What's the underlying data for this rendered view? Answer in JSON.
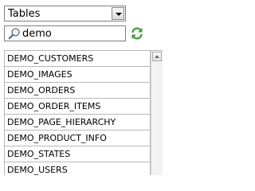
{
  "object_type": {
    "selected": "Tables",
    "options_visible": [
      "Tables"
    ]
  },
  "search": {
    "value": "demo",
    "icon": "search-icon"
  },
  "refresh": {
    "icon": "refresh-icon"
  },
  "objects": [
    {
      "label": "DEMO_CUSTOMERS"
    },
    {
      "label": "DEMO_IMAGES"
    },
    {
      "label": "DEMO_ORDERS"
    },
    {
      "label": "DEMO_ORDER_ITEMS"
    },
    {
      "label": "DEMO_PAGE_HIERARCHY"
    },
    {
      "label": "DEMO_PRODUCT_INFO"
    },
    {
      "label": "DEMO_STATES"
    },
    {
      "label": "DEMO_USERS"
    }
  ],
  "colors": {
    "refresh_green": "#3f9a3f",
    "border": "#7f7f7f",
    "grid": "#b8b8b8"
  }
}
